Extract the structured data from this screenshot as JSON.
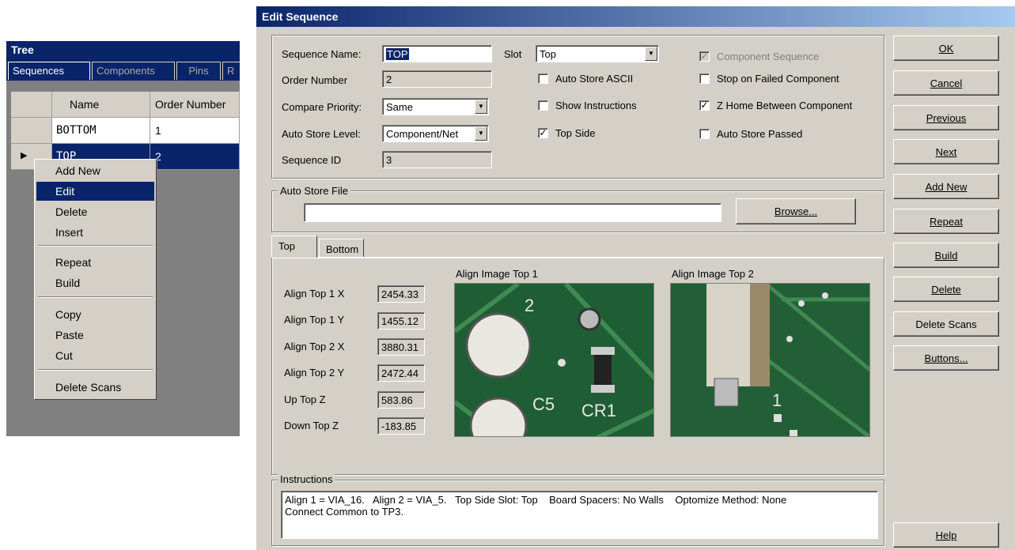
{
  "tree": {
    "title": "Tree",
    "tabs": [
      "Sequences",
      "Components",
      "Pins",
      "R"
    ],
    "columns": [
      "Name",
      "Order Number"
    ],
    "rows": [
      {
        "name": "BOTTOM",
        "order": "1"
      },
      {
        "name": "TOP",
        "order": "2"
      }
    ]
  },
  "context_menu": {
    "items": [
      "Add New",
      "Edit",
      "Delete",
      "Insert",
      "Repeat",
      "Build",
      "Copy",
      "Paste",
      "Cut",
      "Delete Scans"
    ],
    "highlighted": "Edit"
  },
  "dialog": {
    "title": "Edit Sequence",
    "fields": {
      "sequence_name_label": "Sequence Name:",
      "sequence_name_value": "TOP",
      "order_number_label": "Order Number",
      "order_number_value": "2",
      "compare_priority_label": "Compare Priority:",
      "compare_priority_value": "Same",
      "auto_store_level_label": "Auto Store Level:",
      "auto_store_level_value": "Component/Net",
      "sequence_id_label": "Sequence ID",
      "sequence_id_value": "3",
      "slot_label": "Slot",
      "slot_value": "Top"
    },
    "checkboxes": {
      "auto_store_ascii": {
        "label": "Auto Store ASCII",
        "checked": false
      },
      "show_instructions": {
        "label": "Show Instructions",
        "checked": false
      },
      "top_side": {
        "label": "Top Side",
        "checked": true
      },
      "component_sequence": {
        "label": "Component Sequence",
        "checked": true,
        "disabled": true
      },
      "stop_on_failed": {
        "label": "Stop on Failed Component",
        "checked": false
      },
      "z_home": {
        "label": "Z Home Between Component",
        "checked": true
      },
      "auto_store_passed": {
        "label": "Auto Store Passed",
        "checked": false
      }
    },
    "auto_store_file": {
      "label": "Auto Store File",
      "value": "",
      "browse": "Browse..."
    },
    "tabs": [
      "Top",
      "Bottom"
    ],
    "align": [
      {
        "label": "Align Top 1 X",
        "value": "2454.33"
      },
      {
        "label": "Align Top 1 Y",
        "value": "1455.12"
      },
      {
        "label": "Align Top 2 X",
        "value": "3880.31"
      },
      {
        "label": "Align Top 2 Y",
        "value": "2472.44"
      },
      {
        "label": "Up Top Z",
        "value": "583.86"
      },
      {
        "label": "Down Top Z",
        "value": "-183.85"
      }
    ],
    "image1_label": "Align Image Top 1",
    "image2_label": "Align Image Top 2",
    "instructions": {
      "label": "Instructions",
      "line1": "Align 1 = VIA_16.   Align 2 = VIA_5.   Top Side Slot: Top    Board Spacers: No Walls    Optomize Method: None",
      "line2": "Connect Common to TP3."
    },
    "buttons": [
      "OK",
      "Cancel",
      "Previous",
      "Next",
      "Add New",
      "Repeat",
      "Build",
      "Delete",
      "Delete Scans",
      "Buttons...",
      "Help"
    ],
    "colors": {
      "titlebar": "#0a246a",
      "face": "#d4d0c8",
      "pcb": "#1d5a32"
    }
  }
}
